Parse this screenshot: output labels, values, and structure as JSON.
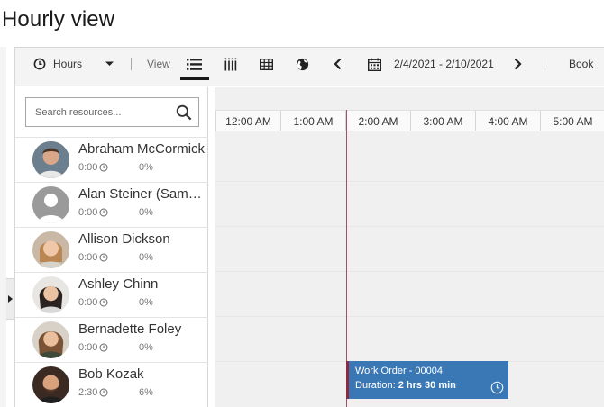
{
  "page": {
    "title": "Hourly view"
  },
  "toolbar": {
    "period_label": "Hours",
    "view_label": "View",
    "date_range": "2/4/2021 - 2/10/2021",
    "book_label": "Book"
  },
  "search": {
    "placeholder": "Search resources..."
  },
  "timeline": {
    "hours": [
      "12:00 AM",
      "1:00 AM",
      "2:00 AM",
      "3:00 AM",
      "4:00 AM",
      "5:00 AM"
    ]
  },
  "resources": [
    {
      "name": "Abraham McCormick",
      "hours": "0:00",
      "utilization": "0%",
      "avatar": "photo"
    },
    {
      "name": "Alan Steiner (Sample Data)",
      "hours": "0:00",
      "utilization": "0%",
      "avatar": "placeholder"
    },
    {
      "name": "Allison Dickson",
      "hours": "0:00",
      "utilization": "0%",
      "avatar": "photo"
    },
    {
      "name": "Ashley Chinn",
      "hours": "0:00",
      "utilization": "0%",
      "avatar": "photo"
    },
    {
      "name": "Bernadette Foley",
      "hours": "0:00",
      "utilization": "0%",
      "avatar": "photo"
    },
    {
      "name": "Bob Kozak",
      "hours": "2:30",
      "utilization": "6%",
      "avatar": "photo"
    }
  ],
  "booking": {
    "title": "Work Order - 00004",
    "duration_label": "Duration:",
    "duration_value": "2 hrs 30 min",
    "color": "#3a78b5",
    "accent_color": "#8b2b3d"
  },
  "colors": {
    "toolbar_bg": "#f4f4f4",
    "grid_bg": "#f0f0f0",
    "current_time_line": "#a0506b"
  }
}
